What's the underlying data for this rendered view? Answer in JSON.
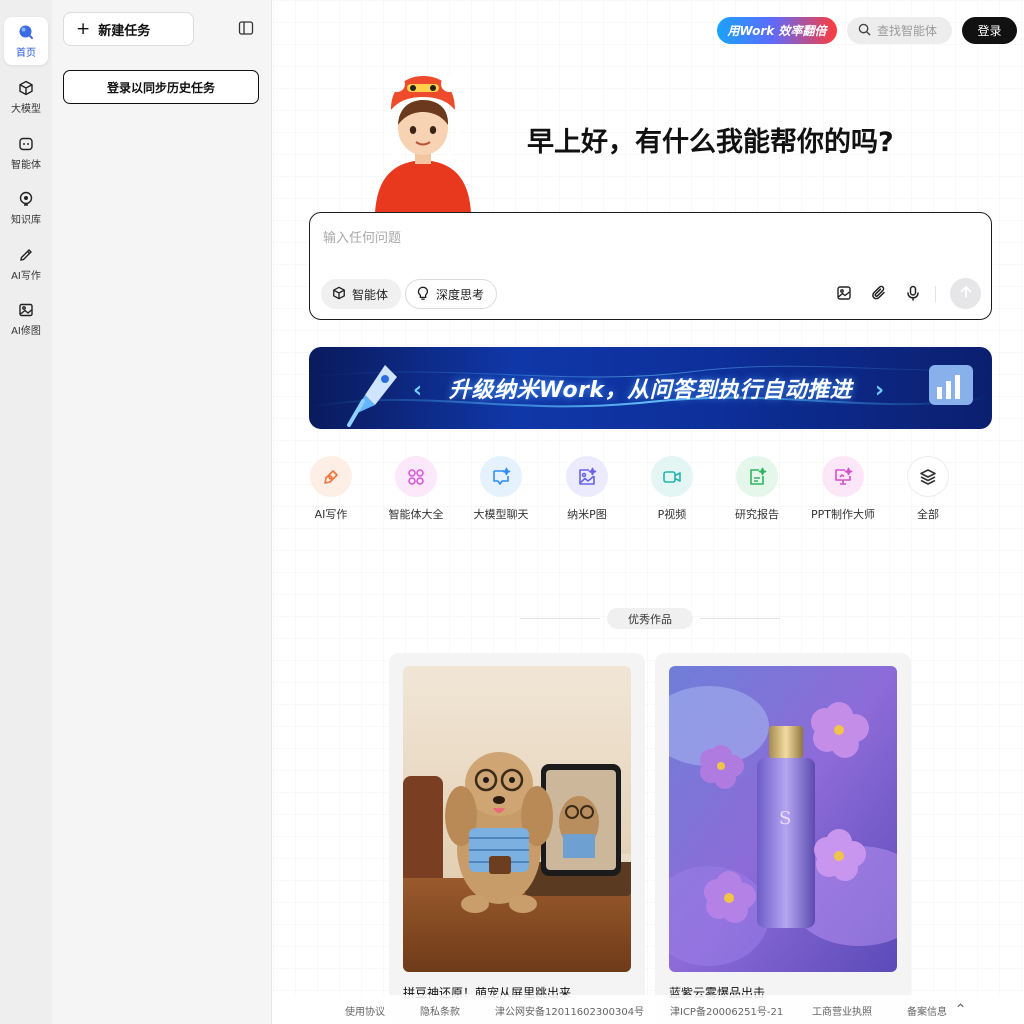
{
  "sidebar": {
    "items": [
      {
        "label": "首页",
        "icon": "home-icon"
      },
      {
        "label": "大模型",
        "icon": "cube-icon"
      },
      {
        "label": "智能体",
        "icon": "robot-icon"
      },
      {
        "label": "知识库",
        "icon": "lightbulb-icon"
      },
      {
        "label": "AI写作",
        "icon": "pen-icon"
      },
      {
        "label": "AI修图",
        "icon": "image-icon"
      }
    ],
    "active_color": "#2a5bd7"
  },
  "history_panel": {
    "new_task_label": "新建任务",
    "login_sync_label": "登录以同步历史任务"
  },
  "header": {
    "promo_label": "用Work 效率翻倍",
    "search_placeholder": "查找智能体",
    "login_label": "登录"
  },
  "greeting": "早上好，有什么我能帮你的吗?",
  "chat": {
    "placeholder": "输入任何问题",
    "agent_label": "智能体",
    "deep_think_label": "深度思考"
  },
  "banner": {
    "text": "升级纳米Work，从问答到执行自动推进"
  },
  "shortcuts": [
    {
      "label": "AI写作",
      "icon": "pen-tool-icon",
      "color": "#f0733a",
      "bg": "#fdeee6"
    },
    {
      "label": "智能体大全",
      "icon": "grid-icon",
      "color": "#d55ad8",
      "bg": "#fbe8fb"
    },
    {
      "label": "大模型聊天",
      "icon": "chat-sparkle-icon",
      "color": "#2f8ef5",
      "bg": "#e6f1fe"
    },
    {
      "label": "纳米P图",
      "icon": "photo-sparkle-icon",
      "color": "#6a63e8",
      "bg": "#ecebfd"
    },
    {
      "label": "P视频",
      "icon": "video-icon",
      "color": "#22b5ad",
      "bg": "#e3f6f4"
    },
    {
      "label": "研究报告",
      "icon": "report-icon",
      "color": "#2fb562",
      "bg": "#e5f6ea"
    },
    {
      "label": "PPT制作大师",
      "icon": "presentation-icon",
      "color": "#d552c9",
      "bg": "#fbe7f8"
    },
    {
      "label": "全部",
      "icon": "layers-icon",
      "color": "#333333",
      "bg": "#ffffff"
    }
  ],
  "featured": {
    "title": "优秀作品",
    "cards": [
      {
        "title": "拼豆神还原！萌宠从屏里跳出来",
        "image": "dog-with-glasses-and-tablet"
      },
      {
        "title": "蓝紫云雾爆品出击",
        "image": "perfume-bottle-purple-flowers"
      }
    ]
  },
  "footer": {
    "links": [
      "使用协议",
      "隐私条款",
      "津公网安备12011602300304号",
      "津ICP备20006251号-21",
      "工商营业执照",
      "备案信息"
    ]
  }
}
